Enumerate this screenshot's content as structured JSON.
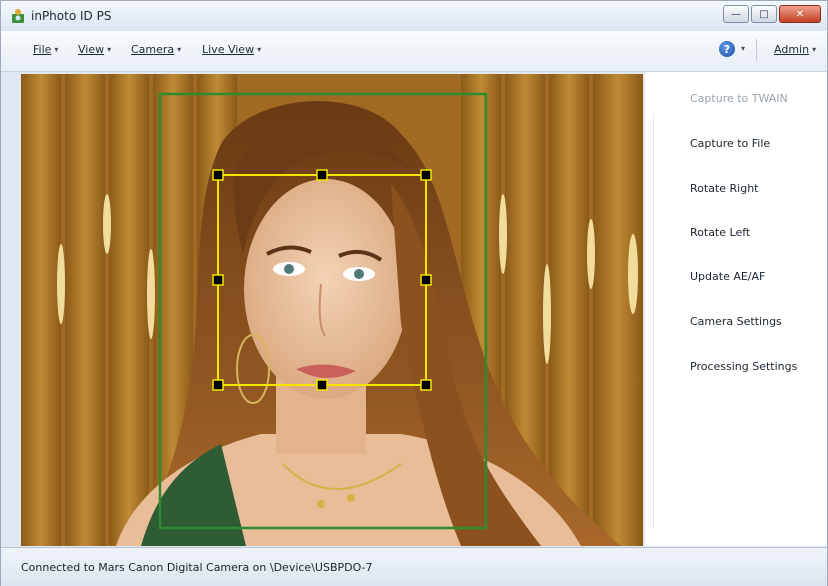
{
  "window": {
    "title": "inPhoto ID PS",
    "controls": {
      "minimize": "—",
      "maximize": "□",
      "close": "✕"
    }
  },
  "menubar": {
    "items": [
      {
        "label": "File",
        "icon": "chevron-down-icon"
      },
      {
        "label": "View",
        "icon": "chevron-down-icon"
      },
      {
        "label": "Camera",
        "icon": "chevron-down-icon"
      },
      {
        "label": "Live View",
        "icon": "chevron-down-icon"
      }
    ],
    "help": {
      "glyph": "?",
      "icon": "help-icon"
    },
    "admin": "Admin"
  },
  "panel": {
    "actions": [
      {
        "label": "Capture to TWAIN",
        "enabled": false
      },
      {
        "label": "Capture to File",
        "enabled": true
      },
      {
        "label": "Rotate Right",
        "enabled": true
      },
      {
        "label": "Rotate Left",
        "enabled": true
      },
      {
        "label": "Update AE/AF",
        "enabled": true
      },
      {
        "label": "Camera Settings",
        "enabled": true
      },
      {
        "label": "Processing Settings",
        "enabled": true
      }
    ]
  },
  "viewport": {
    "crop_frame_color": "#2e8b2e",
    "face_box_color": "#f2e600"
  },
  "status": {
    "text": "Connected to Mars Canon Digital Camera on \\Device\\USBPDO-7"
  }
}
